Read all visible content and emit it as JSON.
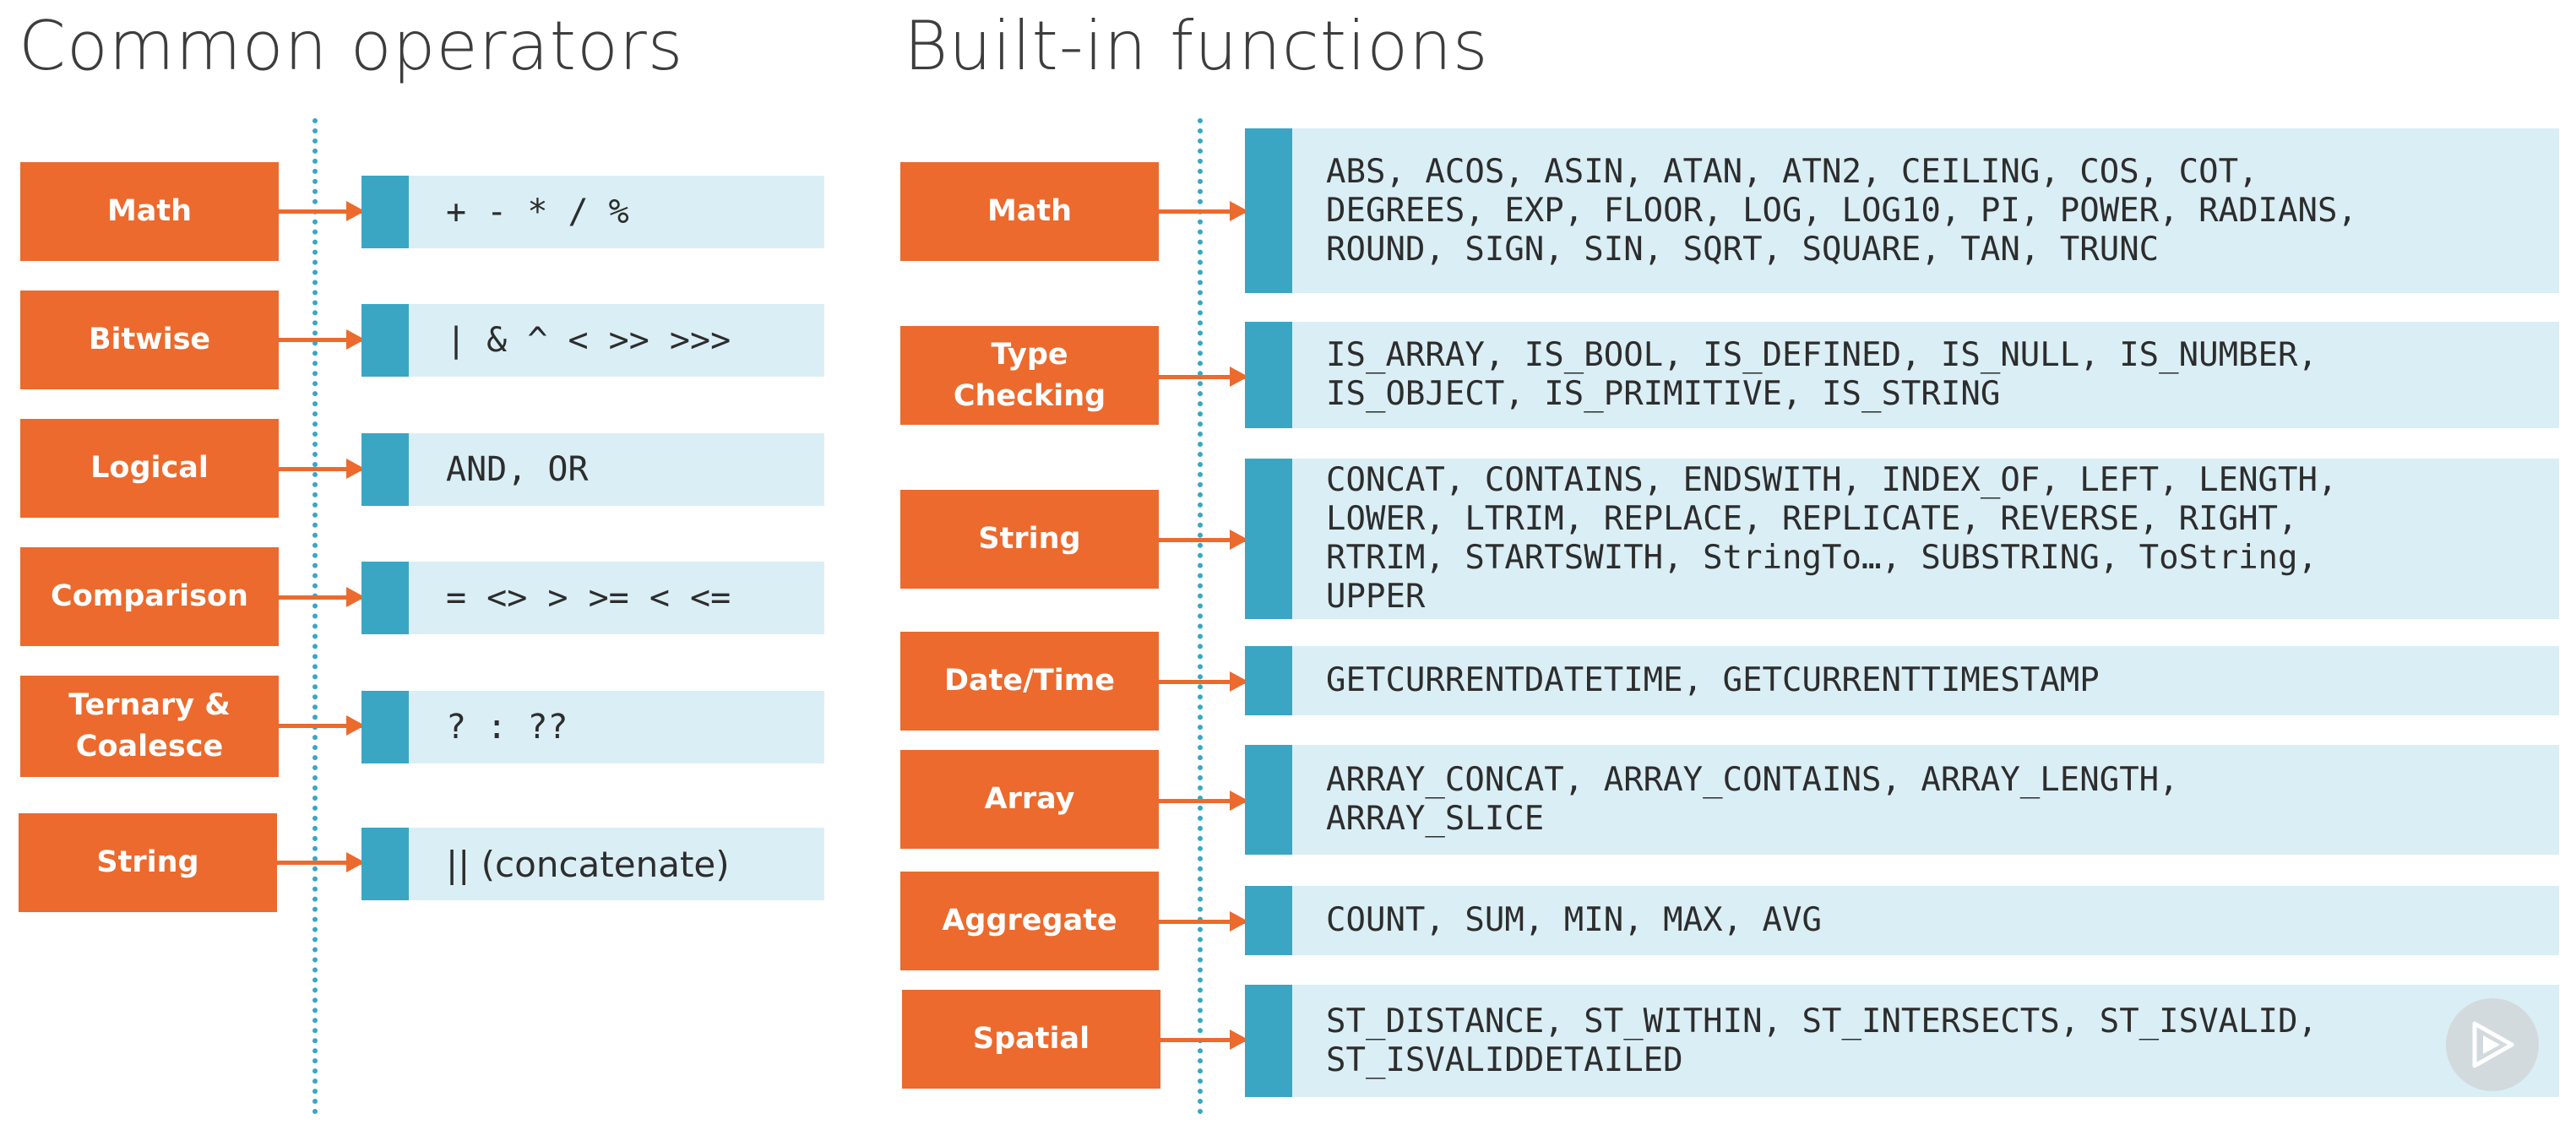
{
  "titles": {
    "left": "Common operators",
    "right": "Built-in functions"
  },
  "operators": [
    {
      "category": "Math",
      "value": "+ - * / %"
    },
    {
      "category": "Bitwise",
      "value": "| & ^ < >> >>>"
    },
    {
      "category": "Logical",
      "value": "AND, OR"
    },
    {
      "category": "Comparison",
      "value": "= <> > >= < <="
    },
    {
      "category": "Ternary & Coalesce",
      "value": "? : ??"
    },
    {
      "category": "String",
      "value": "|| (concatenate)"
    }
  ],
  "functions": [
    {
      "category": "Math",
      "lines": [
        "ABS, ACOS, ASIN, ATAN, ATN2, CEILING, COS, COT,",
        "DEGREES, EXP, FLOOR, LOG, LOG10, PI, POWER, RADIANS,",
        "ROUND, SIGN, SIN, SQRT, SQUARE, TAN, TRUNC"
      ]
    },
    {
      "category": "Type Checking",
      "lines": [
        "IS_ARRAY, IS_BOOL, IS_DEFINED, IS_NULL, IS_NUMBER,",
        "IS_OBJECT, IS_PRIMITIVE, IS_STRING"
      ]
    },
    {
      "category": "String",
      "lines": [
        "CONCAT, CONTAINS, ENDSWITH, INDEX_OF, LEFT, LENGTH,",
        "LOWER, LTRIM, REPLACE, REPLICATE, REVERSE, RIGHT,",
        "RTRIM, STARTSWITH, StringTo…, SUBSTRING, ToString,",
        "UPPER"
      ]
    },
    {
      "category": "Date/Time",
      "lines": [
        "GETCURRENTDATETIME, GETCURRENTTIMESTAMP"
      ]
    },
    {
      "category": "Array",
      "lines": [
        "ARRAY_CONCAT, ARRAY_CONTAINS, ARRAY_LENGTH,",
        "ARRAY_SLICE"
      ]
    },
    {
      "category": "Aggregate",
      "lines": [
        "COUNT, SUM, MIN, MAX, AVG"
      ]
    },
    {
      "category": "Spatial",
      "lines": [
        "ST_DISTANCE, ST_WITHIN, ST_INTERSECTS, ST_ISVALID,",
        "ST_ISVALIDDETAILED"
      ]
    }
  ],
  "controls": {
    "play_icon": "play-icon"
  },
  "colors": {
    "accent_orange": "#ec6a2d",
    "accent_blue": "#3aa6c4",
    "box_fill": "#daeef5"
  }
}
